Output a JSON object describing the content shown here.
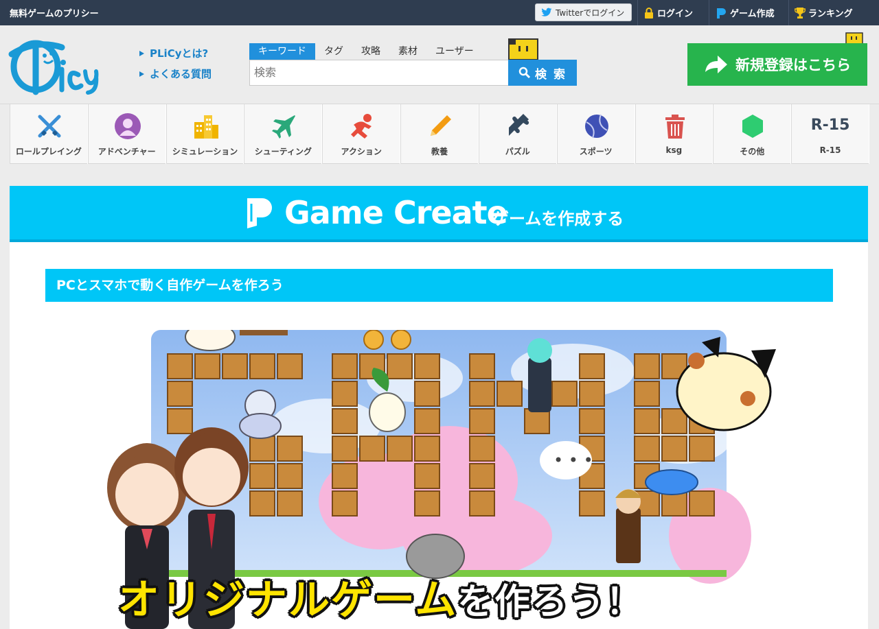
{
  "topbar": {
    "brand": "無料ゲームのプリシー",
    "twitter_login": "Twitterでログイン",
    "login": "ログイン",
    "game_create": "ゲーム作成",
    "ranking": "ランキング"
  },
  "header": {
    "links": [
      "PLiCyとは?",
      "よくある質問"
    ],
    "search_tabs": [
      "キーワード",
      "タグ",
      "攻略",
      "素材",
      "ユーザー"
    ],
    "active_tab": "キーワード",
    "search_placeholder": "検索",
    "search_button": "検 索",
    "register_button": "新規登録はこちら"
  },
  "categories": [
    {
      "label": "ロールプレイング",
      "icon": "swords-icon",
      "color": "#3a8fd6"
    },
    {
      "label": "アドベンチャー",
      "icon": "person-icon",
      "color": "#9b59b6"
    },
    {
      "label": "シミュレーション",
      "icon": "buildings-icon",
      "color": "#f0b400"
    },
    {
      "label": "シューティング",
      "icon": "jet-icon",
      "color": "#2aa87a"
    },
    {
      "label": "アクション",
      "icon": "runner-icon",
      "color": "#e74c3c"
    },
    {
      "label": "教養",
      "icon": "pencil-icon",
      "color": "#f39c12"
    },
    {
      "label": "パズル",
      "icon": "puzzle-icon",
      "color": "#34495e"
    },
    {
      "label": "スポーツ",
      "icon": "ball-icon",
      "color": "#3f51b5"
    },
    {
      "label": "ksg",
      "icon": "trash-icon",
      "color": "#d9534f"
    },
    {
      "label": "その他",
      "icon": "hexagon-icon",
      "color": "#2ecc71"
    },
    {
      "label": "R-15",
      "icon_text": "R-15",
      "color": "#3a4a5c"
    }
  ],
  "main": {
    "banner_title": "Game Create",
    "banner_subtitle": "ゲームを作成する",
    "subheading": "PCとスマホで動く自作ゲームを作ろう",
    "art_caption_main": "オリジナルゲーム",
    "art_caption_rest": "を作ろう！"
  }
}
